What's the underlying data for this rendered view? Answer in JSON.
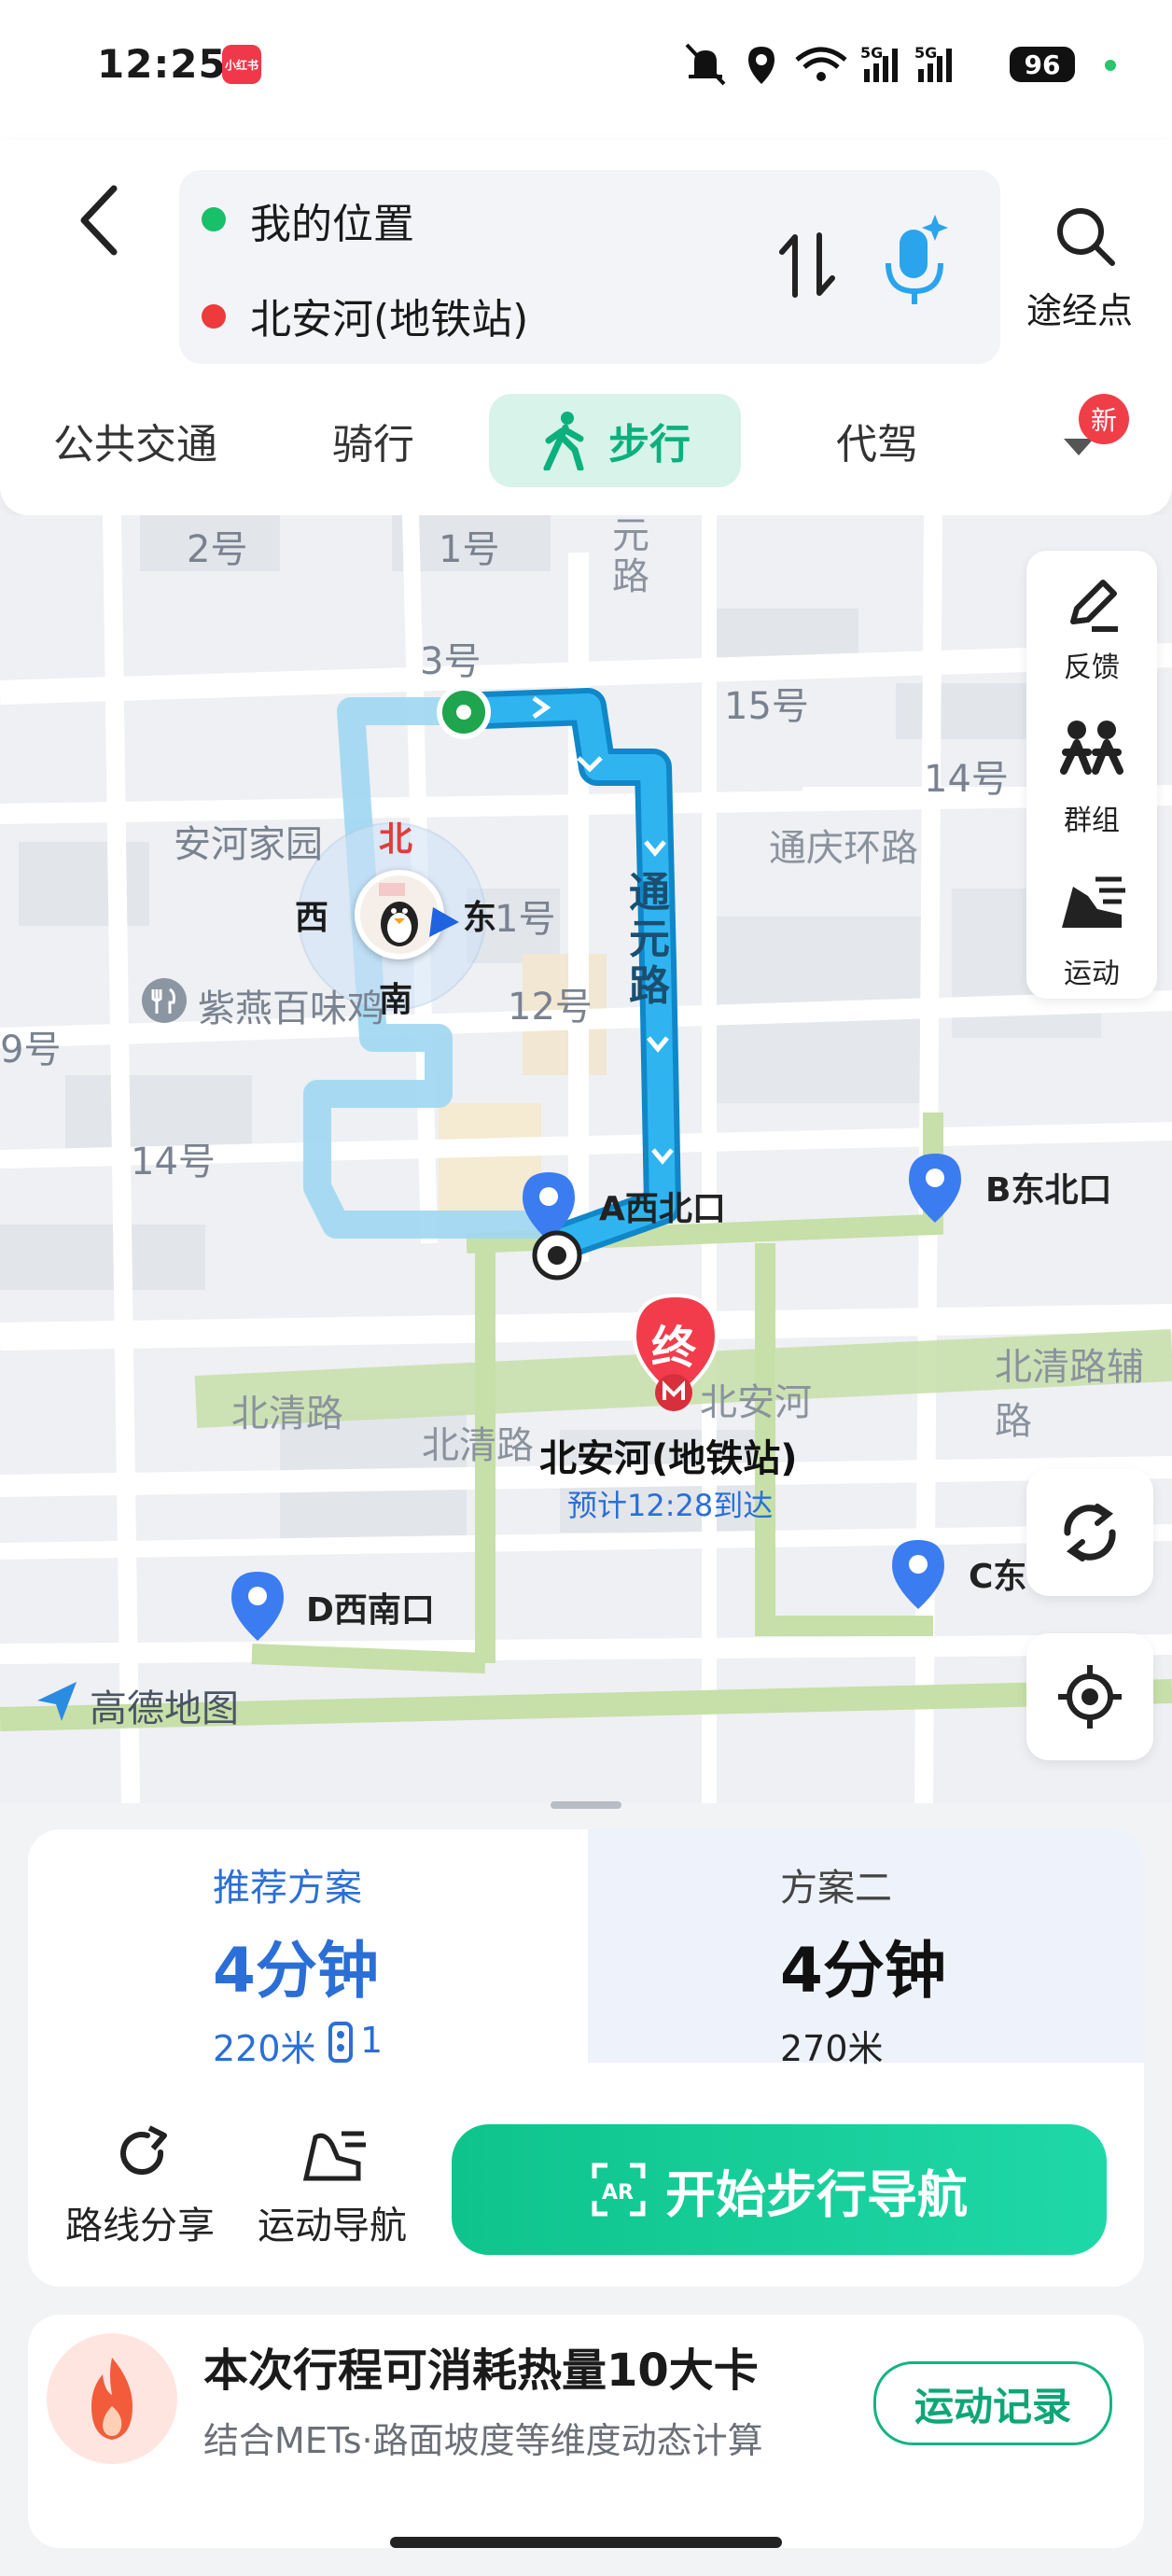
{
  "status_bar": {
    "time": "12:25",
    "app_badge": "小红书",
    "battery": "96",
    "signal1": "5G",
    "signal2": "5G"
  },
  "route": {
    "origin": "我的位置",
    "destination": "北安河(地铁站)",
    "waypoint_label": "途经点"
  },
  "modes": [
    {
      "label": "公共交通"
    },
    {
      "label": "骑行"
    },
    {
      "label": "步行"
    },
    {
      "label": "代驾"
    }
  ],
  "new_badge": "新",
  "side_tools": [
    {
      "label": "反馈"
    },
    {
      "label": "群组"
    },
    {
      "label": "运动"
    }
  ],
  "map": {
    "places": {
      "b2": "2号",
      "b1": "1号",
      "b3": "3号",
      "b15": "15号",
      "b14a": "14号",
      "b11": "1号",
      "b12": "12号",
      "b14b": "14号",
      "b9": "9号",
      "anhe": "安河家园",
      "restaurant": "紫燕百味鸡",
      "yuan_road": "元路",
      "tongqing": "通庆环路",
      "tongyuan": "通元路",
      "beiqing1": "北清路",
      "beiqing2": "北清路",
      "beiqing_aux": "北清路辅路",
      "beianhe": "北安河"
    },
    "compass": {
      "north": "北",
      "west": "西",
      "east": "东",
      "south": "南"
    },
    "exits": {
      "a": "A西北口",
      "b": "B东北口",
      "c": "C东",
      "d": "D西南口"
    },
    "end_marker": "终",
    "destination_name": "北安河(地铁站)",
    "eta": "预计12:28到达",
    "watermark": "高德地图"
  },
  "plans": {
    "recommended": {
      "title": "推荐方案",
      "time": "4分钟",
      "distance": "220米",
      "lights": "1"
    },
    "second": {
      "title": "方案二",
      "time": "4分钟",
      "distance": "270米"
    }
  },
  "actions": {
    "share": "路线分享",
    "sport_nav": "运动导航",
    "start": "开始步行导航",
    "ar": "AR"
  },
  "calorie": {
    "title": "本次行程可消耗热量10大卡",
    "subtitle": "结合METs·路面坡度等维度动态计算",
    "record_button": "运动记录"
  },
  "colors": {
    "accent": "#0fc48c",
    "route": "#1ea7e8",
    "plan_blue": "#2b6fd6",
    "end_red": "#f23c4c"
  }
}
